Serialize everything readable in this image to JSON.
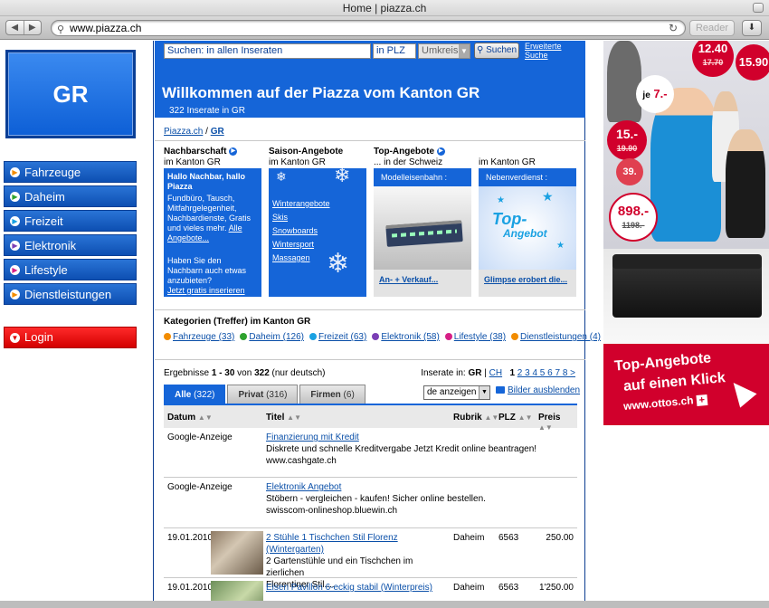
{
  "browser": {
    "title": "Home | piazza.ch",
    "url": "www.piazza.ch",
    "reader": "Reader",
    "nav_back": "◀",
    "nav_forward": "▶",
    "reload_icon": "↻",
    "download_icon": "⬇"
  },
  "left": {
    "logo": "GR",
    "nav": [
      {
        "label": "Fahrzeuge",
        "color": "#f28c00"
      },
      {
        "label": "Daheim",
        "color": "#2ea22e"
      },
      {
        "label": "Freizeit",
        "color": "#1aa1e2"
      },
      {
        "label": "Elektronik",
        "color": "#7b3fb5"
      },
      {
        "label": "Lifestyle",
        "color": "#d61f86"
      },
      {
        "label": "Dienstleistungen",
        "color": "#f28c00"
      }
    ],
    "login": "Login"
  },
  "search": {
    "input": "Suchen: in allen Inseraten",
    "plz": "in PLZ",
    "umkreis": "Umkreis",
    "button": "Suchen",
    "extended": "Erweiterte Suche"
  },
  "welcome": {
    "title": "Willkommen auf der Piazza vom Kanton GR",
    "subtitle": "322 Inserate in GR"
  },
  "breadcrumb": {
    "home": "Piazza.ch",
    "sep": " / ",
    "current": "GR"
  },
  "promos": {
    "nachbarschaft": {
      "head": "Nachbarschaft",
      "sub": "im Kanton GR",
      "greeting": "Hallo Nachbar, hallo Piazza",
      "text": "Fundbüro, Tausch, Mitfahrgelegenheit, Nachbardienste, Gratis und vieles mehr.",
      "link": "Alle Angebote...",
      "q": "Haben Sie den Nachbarn auch etwas anzubieten?",
      "cta": "Jetzt gratis inserieren"
    },
    "saison": {
      "head": "Saison-Angebote",
      "sub": "im Kanton GR",
      "links": [
        "Winterangebote",
        "Skis",
        "Snowboards",
        "Wintersport",
        "Massagen"
      ]
    },
    "top": {
      "head": "Top-Angebote",
      "sub": "... in der Schweiz",
      "box_title": "Modelleisenbahn :",
      "caption": "An- + Verkauf..."
    },
    "kanton": {
      "head": "",
      "sub": "im Kanton GR",
      "box_title": "Nebenverdienst :",
      "img_text": "Top-",
      "img_text2": "Angebot",
      "caption": "Glimpse erobert die..."
    }
  },
  "categories": {
    "title": "Kategorien (Treffer) im Kanton GR",
    "items": [
      {
        "label": "Fahrzeuge (33)",
        "color": "#f28c00"
      },
      {
        "label": "Daheim (126)",
        "color": "#2ea22e"
      },
      {
        "label": "Freizeit (63)",
        "color": "#1aa1e2"
      },
      {
        "label": "Elektronik (58)",
        "color": "#7b3fb5"
      },
      {
        "label": "Lifestyle (38)",
        "color": "#d61f86"
      },
      {
        "label": "Dienstleistungen (4)",
        "color": "#f28c00"
      }
    ]
  },
  "results": {
    "summary_pre": "Ergebnisse ",
    "summary_range": "1 - 30",
    "summary_mid": " von ",
    "summary_total": "322",
    "summary_post": " (nur deutsch)",
    "inserate_in": "Inserate in: ",
    "region_gr": "GR",
    "region_sep": " | ",
    "region_ch": "CH",
    "pages_current": "1",
    "pages": "2 3 4 5 6 7 8 >",
    "tabs": [
      {
        "label": "Alle",
        "count": "(322)"
      },
      {
        "label": "Privat",
        "count": "(316)"
      },
      {
        "label": "Firmen",
        "count": "(6)"
      }
    ],
    "show_select": "de anzeigen",
    "images_toggle": "Bilder ausblenden",
    "headers": {
      "datum": "Datum",
      "titel": "Titel",
      "rubrik": "Rubrik",
      "plz": "PLZ",
      "preis": "Preis",
      "sort": "▲▼"
    },
    "rows": [
      {
        "date": "Google-Anzeige",
        "title": "Finanzierung mit Kredit",
        "desc": "Diskrete und schnelle Kreditvergabe Jetzt Kredit online beantragen!",
        "desc2": "www.cashgate.ch",
        "rubrik": "",
        "plz": "",
        "preis": ""
      },
      {
        "date": "Google-Anzeige",
        "title": "Elektronik Angebot",
        "desc": "Stöbern - vergleichen - kaufen! Sicher online bestellen.",
        "desc2": "swisscom-onlineshop.bluewin.ch",
        "rubrik": "",
        "plz": "",
        "preis": ""
      },
      {
        "date": "19.01.2010",
        "title": "2 Stühle 1 Tischchen Stil Florenz (Wintergarten)",
        "desc": "2 Gartenstühle und ein Tischchen im zierlichen",
        "desc2": "Florentiner Stil....",
        "rubrik": "Daheim",
        "plz": "6563",
        "preis": "250.00"
      },
      {
        "date": "19.01.2010",
        "title": "Eisen Pavillon 6-eckig stabil (Winterpreis)",
        "desc": "",
        "desc2": "",
        "rubrik": "Daheim",
        "plz": "6563",
        "preis": "1'250.00"
      }
    ]
  },
  "ad": {
    "price1": "12.40",
    "price1_old": "17.70",
    "price2": "15.90",
    "je": "je",
    "je_price": "7.-",
    "price3": "15.-",
    "price3_old": "19.90",
    "price4": "39.",
    "price5": "898.-",
    "price5_old": "1198.-",
    "headline1": "Top-Angebote",
    "headline2": "auf einen Klick",
    "domain": "www.ottos.ch"
  }
}
